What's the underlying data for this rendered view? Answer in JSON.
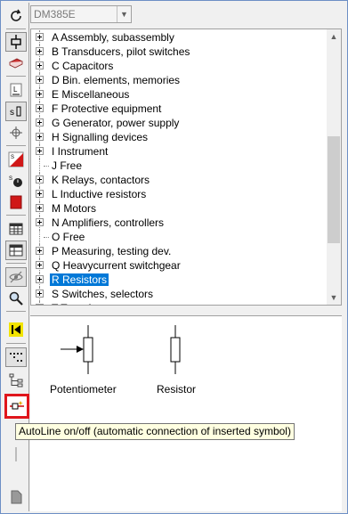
{
  "combo": {
    "value": "DM385E"
  },
  "tree": {
    "items": [
      {
        "label": "A Assembly, subassembly",
        "expandable": true
      },
      {
        "label": "B Transducers, pilot switches",
        "expandable": true
      },
      {
        "label": "C Capacitors",
        "expandable": true
      },
      {
        "label": "D Bin. elements, memories",
        "expandable": true
      },
      {
        "label": "E Miscellaneous",
        "expandable": true
      },
      {
        "label": "F Protective equipment",
        "expandable": true
      },
      {
        "label": "G Generator, power supply",
        "expandable": true
      },
      {
        "label": "H Signalling devices",
        "expandable": true
      },
      {
        "label": "I Instrument",
        "expandable": true
      },
      {
        "label": "J Free",
        "expandable": false
      },
      {
        "label": "K Relays, contactors",
        "expandable": true
      },
      {
        "label": "L Inductive resistors",
        "expandable": true
      },
      {
        "label": "M Motors",
        "expandable": true
      },
      {
        "label": "N Amplifiers, controllers",
        "expandable": true
      },
      {
        "label": "O Free",
        "expandable": false
      },
      {
        "label": "P Measuring, testing dev.",
        "expandable": true
      },
      {
        "label": "Q Heavycurrent switchgear",
        "expandable": true
      },
      {
        "label": "R Resistors",
        "expandable": true,
        "selected": true
      },
      {
        "label": "S Switches, selectors",
        "expandable": true
      },
      {
        "label": "T Transformers",
        "expandable": true
      }
    ]
  },
  "preview": {
    "symbols": [
      {
        "label": "Potentiometer",
        "icon": "potentiometer-symbol"
      },
      {
        "label": "Resistor",
        "icon": "resistor-symbol"
      }
    ]
  },
  "tooltip": {
    "text": "AutoLine on/off (automatic connection of inserted symbol)"
  },
  "colors": {
    "selection": "#0078d7",
    "highlight_border": "#e0161c",
    "tooltip_bg": "#ffffe1"
  }
}
